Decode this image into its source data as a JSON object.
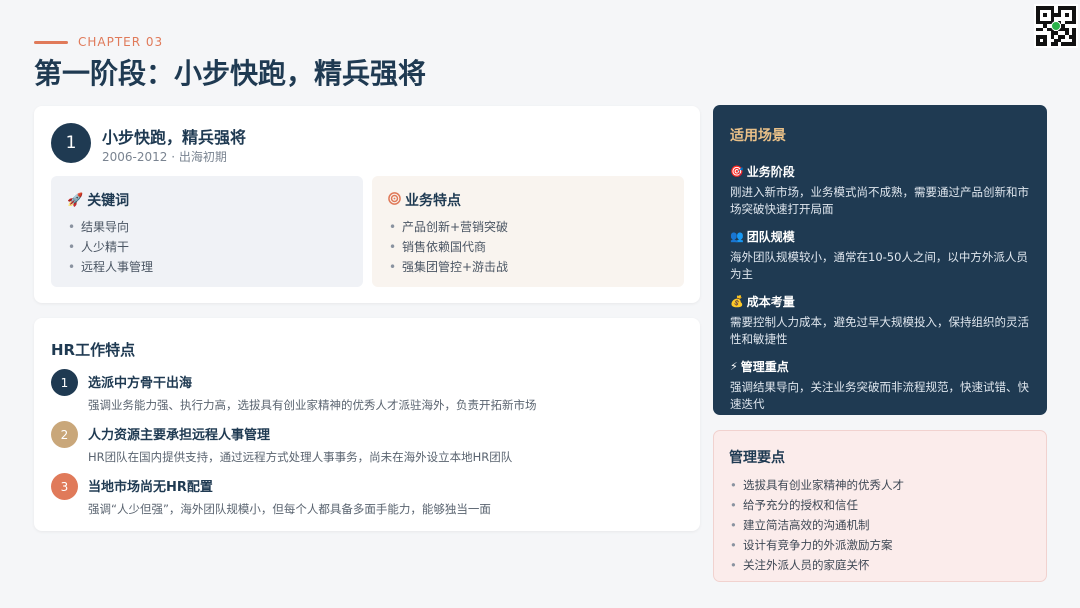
{
  "header": {
    "chapter": "CHAPTER 03",
    "title": "第一阶段：小步快跑，精兵强将"
  },
  "stage": {
    "number": "1",
    "title": "小步快跑，精兵强将",
    "subtitle": "2006-2012 · 出海初期"
  },
  "keywords": {
    "icon": "rocket-icon",
    "title": "关键词",
    "items": [
      "结果导向",
      "人少精干",
      "远程人事管理"
    ]
  },
  "business": {
    "icon": "target-icon",
    "title": "业务特点",
    "items": [
      "产品创新+营销突破",
      "销售依赖国代商",
      "强集团管控+游击战"
    ]
  },
  "hr": {
    "title": "HR工作特点",
    "items": [
      {
        "num": "1",
        "color": "#1f3a52",
        "title": "选派中方骨干出海",
        "desc": "强调业务能力强、执行力高，选拔具有创业家精神的优秀人才派驻海外，负责开拓新市场"
      },
      {
        "num": "2",
        "color": "#c9a77a",
        "title": "人力资源主要承担远程人事管理",
        "desc": "HR团队在国内提供支持，通过远程方式处理人事事务，尚未在海外设立本地HR团队"
      },
      {
        "num": "3",
        "color": "#e07a5a",
        "title": "当地市场尚无HR配置",
        "desc": "强调“人少但强”，海外团队规模小，但每个人都具备多面手能力，能够独当一面"
      }
    ]
  },
  "scenarios": {
    "title": "适用场景",
    "items": [
      {
        "icon": "dart-icon",
        "glyph": "🎯",
        "title": "业务阶段",
        "desc": "刚进入新市场，业务模式尚不成熟，需要通过产品创新和市场突破快速打开局面"
      },
      {
        "icon": "team-icon",
        "glyph": "👥",
        "title": "团队规模",
        "desc": "海外团队规模较小，通常在10-50人之间，以中方外派人员为主"
      },
      {
        "icon": "money-bag-icon",
        "glyph": "💰",
        "title": "成本考量",
        "desc": "需要控制人力成本，避免过早大规模投入，保持组织的灵活性和敏捷性"
      },
      {
        "icon": "lightning-icon",
        "glyph": "⚡",
        "title": "管理重点",
        "desc": "强调结果导向，关注业务突破而非流程规范，快速试错、快速迭代"
      }
    ]
  },
  "management": {
    "title": "管理要点",
    "items": [
      "选拔具有创业家精神的优秀人才",
      "给予充分的授权和信任",
      "建立简洁高效的沟通机制",
      "设计有竞争力的外派激励方案",
      "关注外派人员的家庭关怀"
    ]
  },
  "colors": {
    "navy": "#1f3a52",
    "accent": "#e07a5a",
    "gold": "#c9a77a"
  }
}
